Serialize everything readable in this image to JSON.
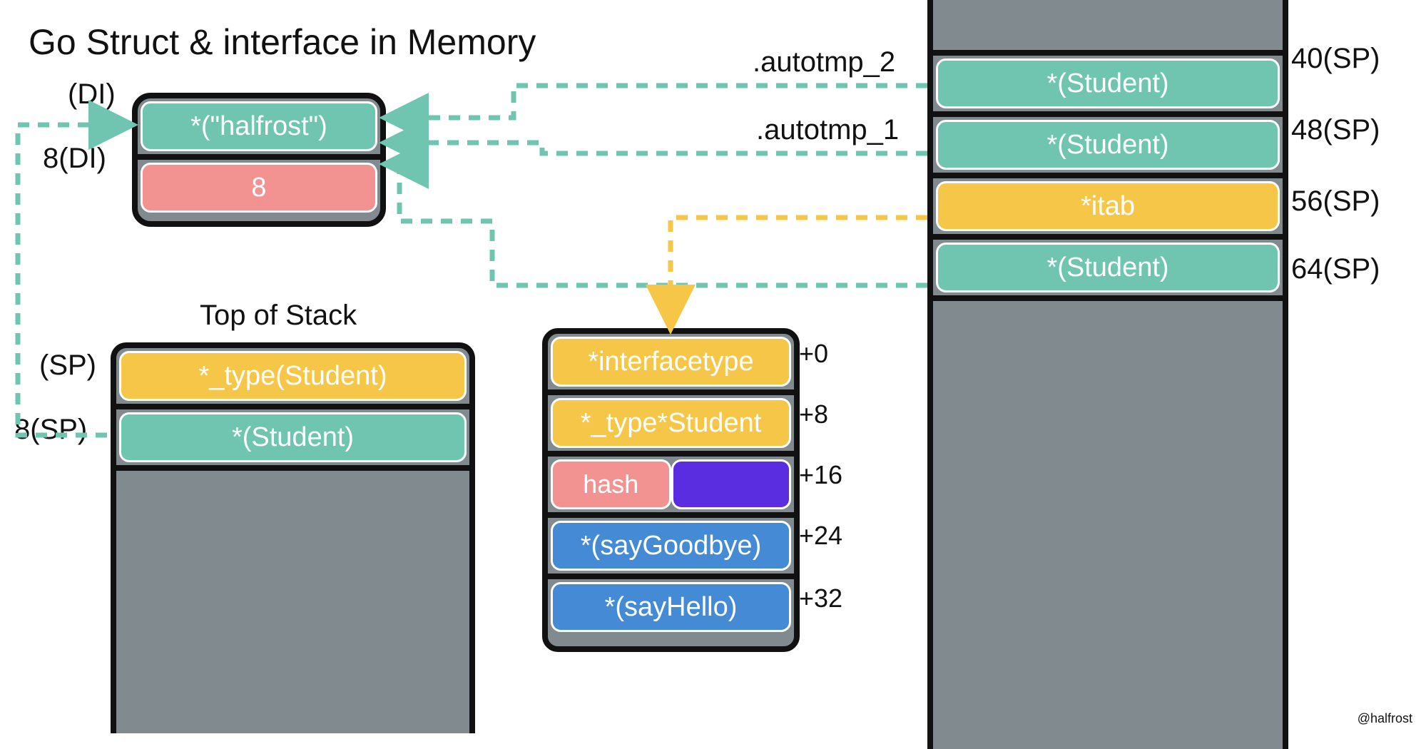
{
  "title": "Go Struct & interface in Memory",
  "credit": "@halfrost",
  "di_box": {
    "left_labels": [
      "(DI)",
      "8(DI)"
    ],
    "cells": [
      {
        "text": "*(\"halfrost\")",
        "color": "teal"
      },
      {
        "text": "8",
        "color": "pink"
      }
    ]
  },
  "stack_top": {
    "title": "Top of Stack",
    "left_labels": [
      "(SP)",
      "8(SP)"
    ],
    "cells": [
      {
        "text": "*_type(Student)",
        "color": "yellow"
      },
      {
        "text": "*(Student)",
        "color": "teal"
      }
    ]
  },
  "itab_box": {
    "offsets": [
      "+0",
      "+8",
      "+16",
      "+24",
      "+32"
    ],
    "cells": [
      {
        "text": "*interfacetype",
        "color": "yellow"
      },
      {
        "text": "*_type*Student",
        "color": "yellow"
      },
      {
        "left": "hash",
        "left_color": "pink",
        "right_color": "purple"
      },
      {
        "text": "*(sayGoodbye)",
        "color": "blue"
      },
      {
        "text": "*(sayHello)",
        "color": "blue"
      }
    ]
  },
  "right_stack": {
    "top_labels": [
      ".autotmp_2",
      ".autotmp_1"
    ],
    "right_offsets": [
      "40(SP)",
      "48(SP)",
      "56(SP)",
      "64(SP)"
    ],
    "cells": [
      {
        "text": "*(Student)",
        "color": "teal"
      },
      {
        "text": "*(Student)",
        "color": "teal"
      },
      {
        "text": "*itab",
        "color": "yellow"
      },
      {
        "text": "*(Student)",
        "color": "teal"
      }
    ]
  }
}
